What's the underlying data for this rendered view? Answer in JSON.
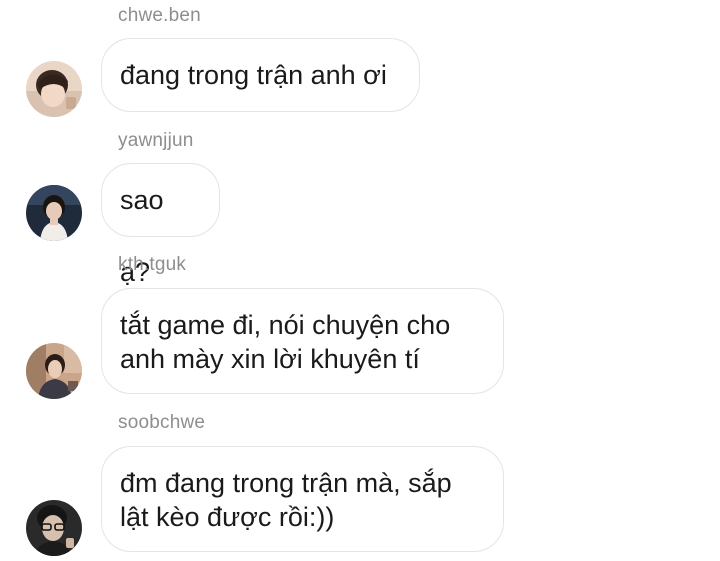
{
  "messages": [
    {
      "username": "chwe.ben",
      "text": "đang trong trận anh ơi",
      "avatar": "avatar-photo-1"
    },
    {
      "username": "yawnjjun",
      "text": "sao ạ?",
      "avatar": "avatar-photo-2"
    },
    {
      "username": "kth.tguk",
      "text": "tắt game đi, nói chuyện cho\nanh mày xin lời khuyên tí",
      "avatar": "avatar-photo-3"
    },
    {
      "username": "soobchwe",
      "text": "đm đang trong trận mà, sắp\nlật kèo được rồi:))",
      "avatar": "avatar-photo-4"
    }
  ],
  "colors": {
    "username": "#8e8e8e",
    "bubble_border": "#e4e4e4",
    "text": "#1a1a1a",
    "background": "#ffffff"
  }
}
